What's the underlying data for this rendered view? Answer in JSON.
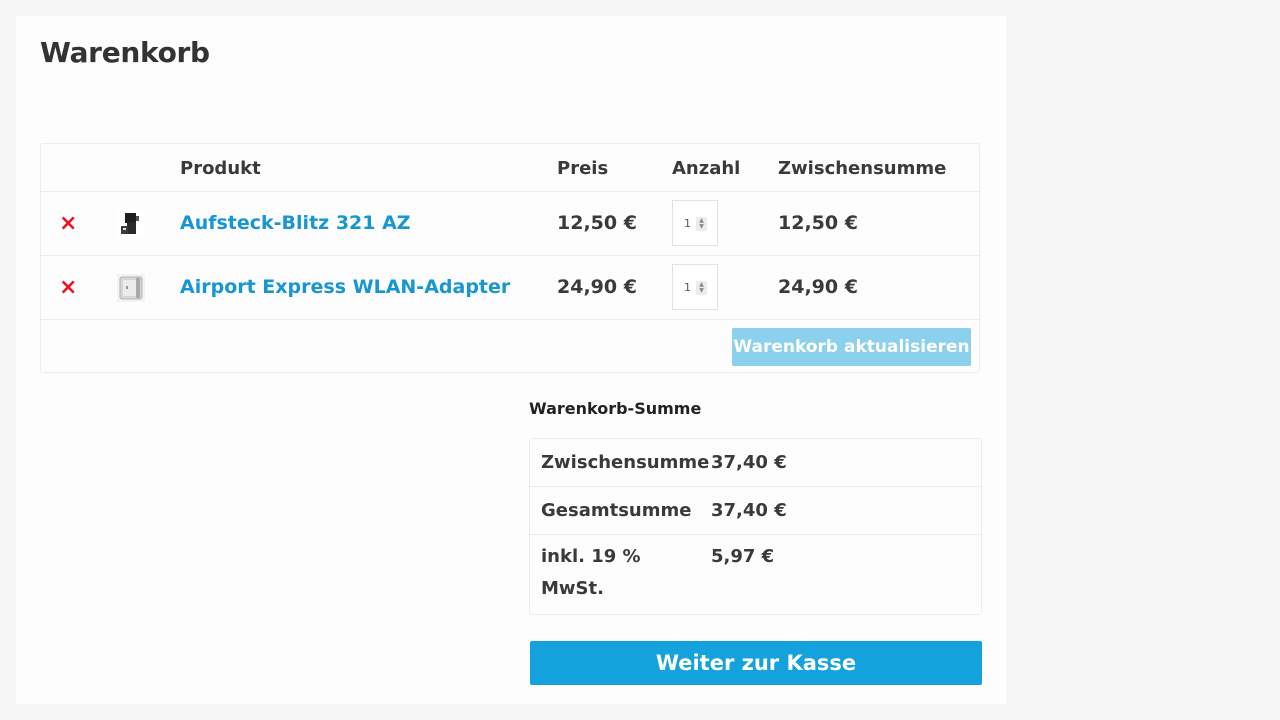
{
  "page": {
    "title": "Warenkorb"
  },
  "cart": {
    "headers": {
      "product": "Produkt",
      "price": "Preis",
      "quantity": "Anzahl",
      "subtotal": "Zwischensumme"
    },
    "items": [
      {
        "remove_icon": "×",
        "thumbnail_icon": "camera-flash-thumbnail",
        "name": "Aufsteck-Blitz 321 AZ",
        "price": "12,50 €",
        "quantity": "1",
        "subtotal": "12,50 €"
      },
      {
        "remove_icon": "×",
        "thumbnail_icon": "wlan-adapter-thumbnail",
        "name": "Airport Express WLAN-Adapter",
        "price": "24,90 €",
        "quantity": "1",
        "subtotal": "24,90 €"
      }
    ],
    "update_button": "Warenkorb aktualisieren"
  },
  "totals": {
    "title": "Warenkorb-Summe",
    "rows": [
      {
        "label": "Zwischensumme",
        "value": "37,40 €"
      },
      {
        "label": "Gesamtsumme",
        "value": "37,40 €"
      },
      {
        "label": "inkl. 19 % MwSt.",
        "value": "5,97 €"
      }
    ],
    "checkout_button": "Weiter zur Kasse"
  },
  "colors": {
    "link": "#1796d2",
    "remove": "#e8141c",
    "update_button_bg": "#8bd0ec",
    "checkout_button_bg": "#13a2dc",
    "page_bg": "#f6f6f6",
    "panel_bg": "#fdfdfe"
  }
}
